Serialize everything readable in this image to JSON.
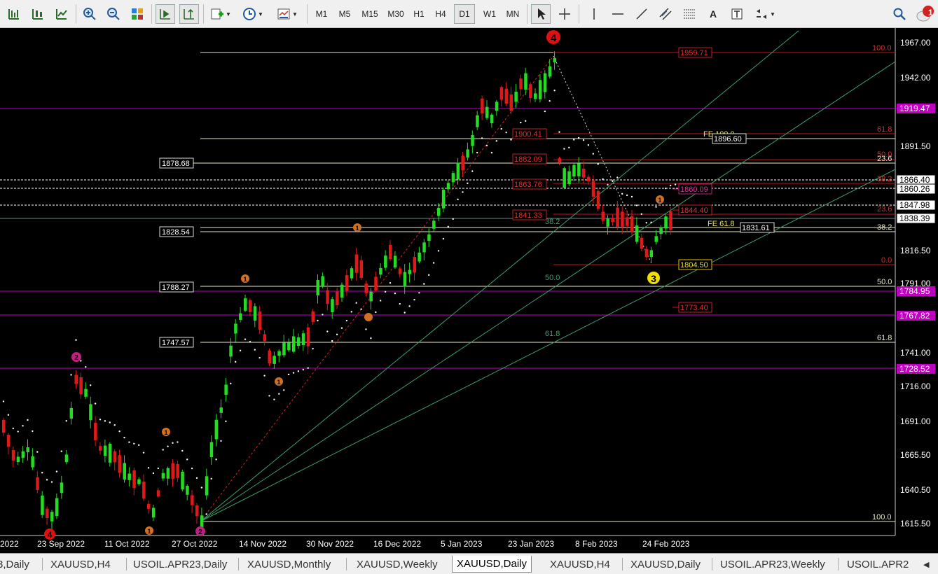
{
  "toolbar": {
    "timeframes": [
      "M1",
      "M5",
      "M15",
      "M30",
      "H1",
      "H4",
      "D1",
      "W1",
      "MN"
    ],
    "active_timeframe": "D1",
    "notification_count": "1"
  },
  "chart_data": {
    "type": "candlestick",
    "symbol": "XAUUSD",
    "timeframe": "Daily",
    "y_ticks": [
      "1967.00",
      "1942.00",
      "1891.50",
      "1866.40",
      "1841.00",
      "1816.50",
      "1791.00",
      "1741.00",
      "1716.00",
      "1691.00",
      "1665.50",
      "1640.50",
      "1615.50"
    ],
    "x_ticks": [
      "2022",
      "23 Sep 2022",
      "11 Oct 2022",
      "27 Oct 2022",
      "14 Nov 2022",
      "30 Nov 2022",
      "16 Dec 2022",
      "5 Jan 2023",
      "23 Jan 2023",
      "8 Feb 2023",
      "24 Feb 2023"
    ],
    "price_tags": [
      "1919.47",
      "1866.40",
      "1860.26",
      "1847.98",
      "1838.39",
      "1784.95",
      "1767.82",
      "1728.52"
    ],
    "left_levels": [
      "1878.68",
      "1828.54",
      "1788.27",
      "1747.57"
    ],
    "fib_retracement": [
      "100.0",
      "61.8",
      "50.0",
      "38.2",
      "23.6",
      "0.0",
      "61.8",
      "50.0",
      "38.2",
      "23.6",
      "100.0"
    ],
    "fib_fan": [
      "38.2",
      "50.0",
      "61.8"
    ],
    "fib_expansion": [
      "FE 100.0",
      "FE 61.8"
    ],
    "box_labels": [
      "1959.71",
      "1900.41",
      "1882.09",
      "1863.76",
      "1860.09",
      "1841.33",
      "1844.40",
      "1896.60",
      "1831.61",
      "1804.50",
      "1773.40"
    ],
    "wave_labels": [
      "4",
      "3",
      "1",
      "2",
      "1",
      "1",
      "1",
      "1",
      "2",
      "4",
      "1"
    ]
  },
  "tabs": [
    "3,Daily",
    "XAUUSD,H4",
    "USOIL.APR23,Daily",
    "XAUUSD,Monthly",
    "XAUUSD,Weekly",
    "XAUUSD,Daily",
    "XAUUSD,H4",
    "XAUUSD,Daily",
    "USOIL.APR23,Weekly",
    "USOIL.APR2"
  ],
  "active_tab": "XAUUSD,Daily"
}
